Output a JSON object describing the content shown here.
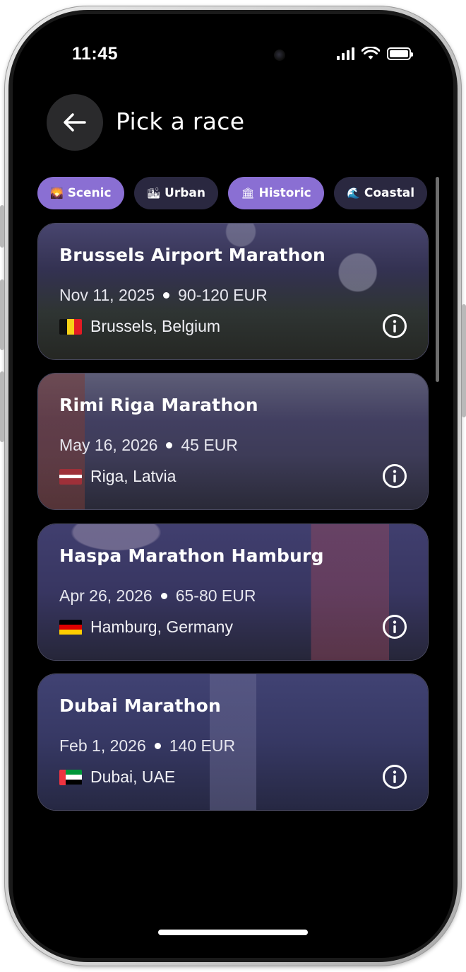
{
  "status": {
    "time": "11:45"
  },
  "header": {
    "title": "Pick a race"
  },
  "chips": [
    {
      "icon": "🌄",
      "label": "Scenic",
      "active": true
    },
    {
      "icon": "🏙",
      "label": "Urban",
      "active": false
    },
    {
      "icon": "🏛",
      "label": "Historic",
      "active": true
    },
    {
      "icon": "🌊",
      "label": "Coastal",
      "active": false
    }
  ],
  "races": [
    {
      "name": "Brussels Airport Marathon",
      "date": "Nov 11, 2025",
      "price": "90-120 EUR",
      "location": "Brussels, Belgium",
      "flag": "belgium"
    },
    {
      "name": "Rimi Riga Marathon",
      "date": "May 16, 2026",
      "price": "45 EUR",
      "location": "Riga, Latvia",
      "flag": "latvia"
    },
    {
      "name": "Haspa Marathon Hamburg",
      "date": "Apr 26, 2026",
      "price": "65-80 EUR",
      "location": "Hamburg, Germany",
      "flag": "germany"
    },
    {
      "name": "Dubai Marathon",
      "date": "Feb 1, 2026",
      "price": "140 EUR",
      "location": "Dubai, UAE",
      "flag": "uae"
    }
  ],
  "colors": {
    "chip_active": "#8a6fd3",
    "chip_inactive": "#2a2840",
    "card_tint": "#3d3a68"
  }
}
